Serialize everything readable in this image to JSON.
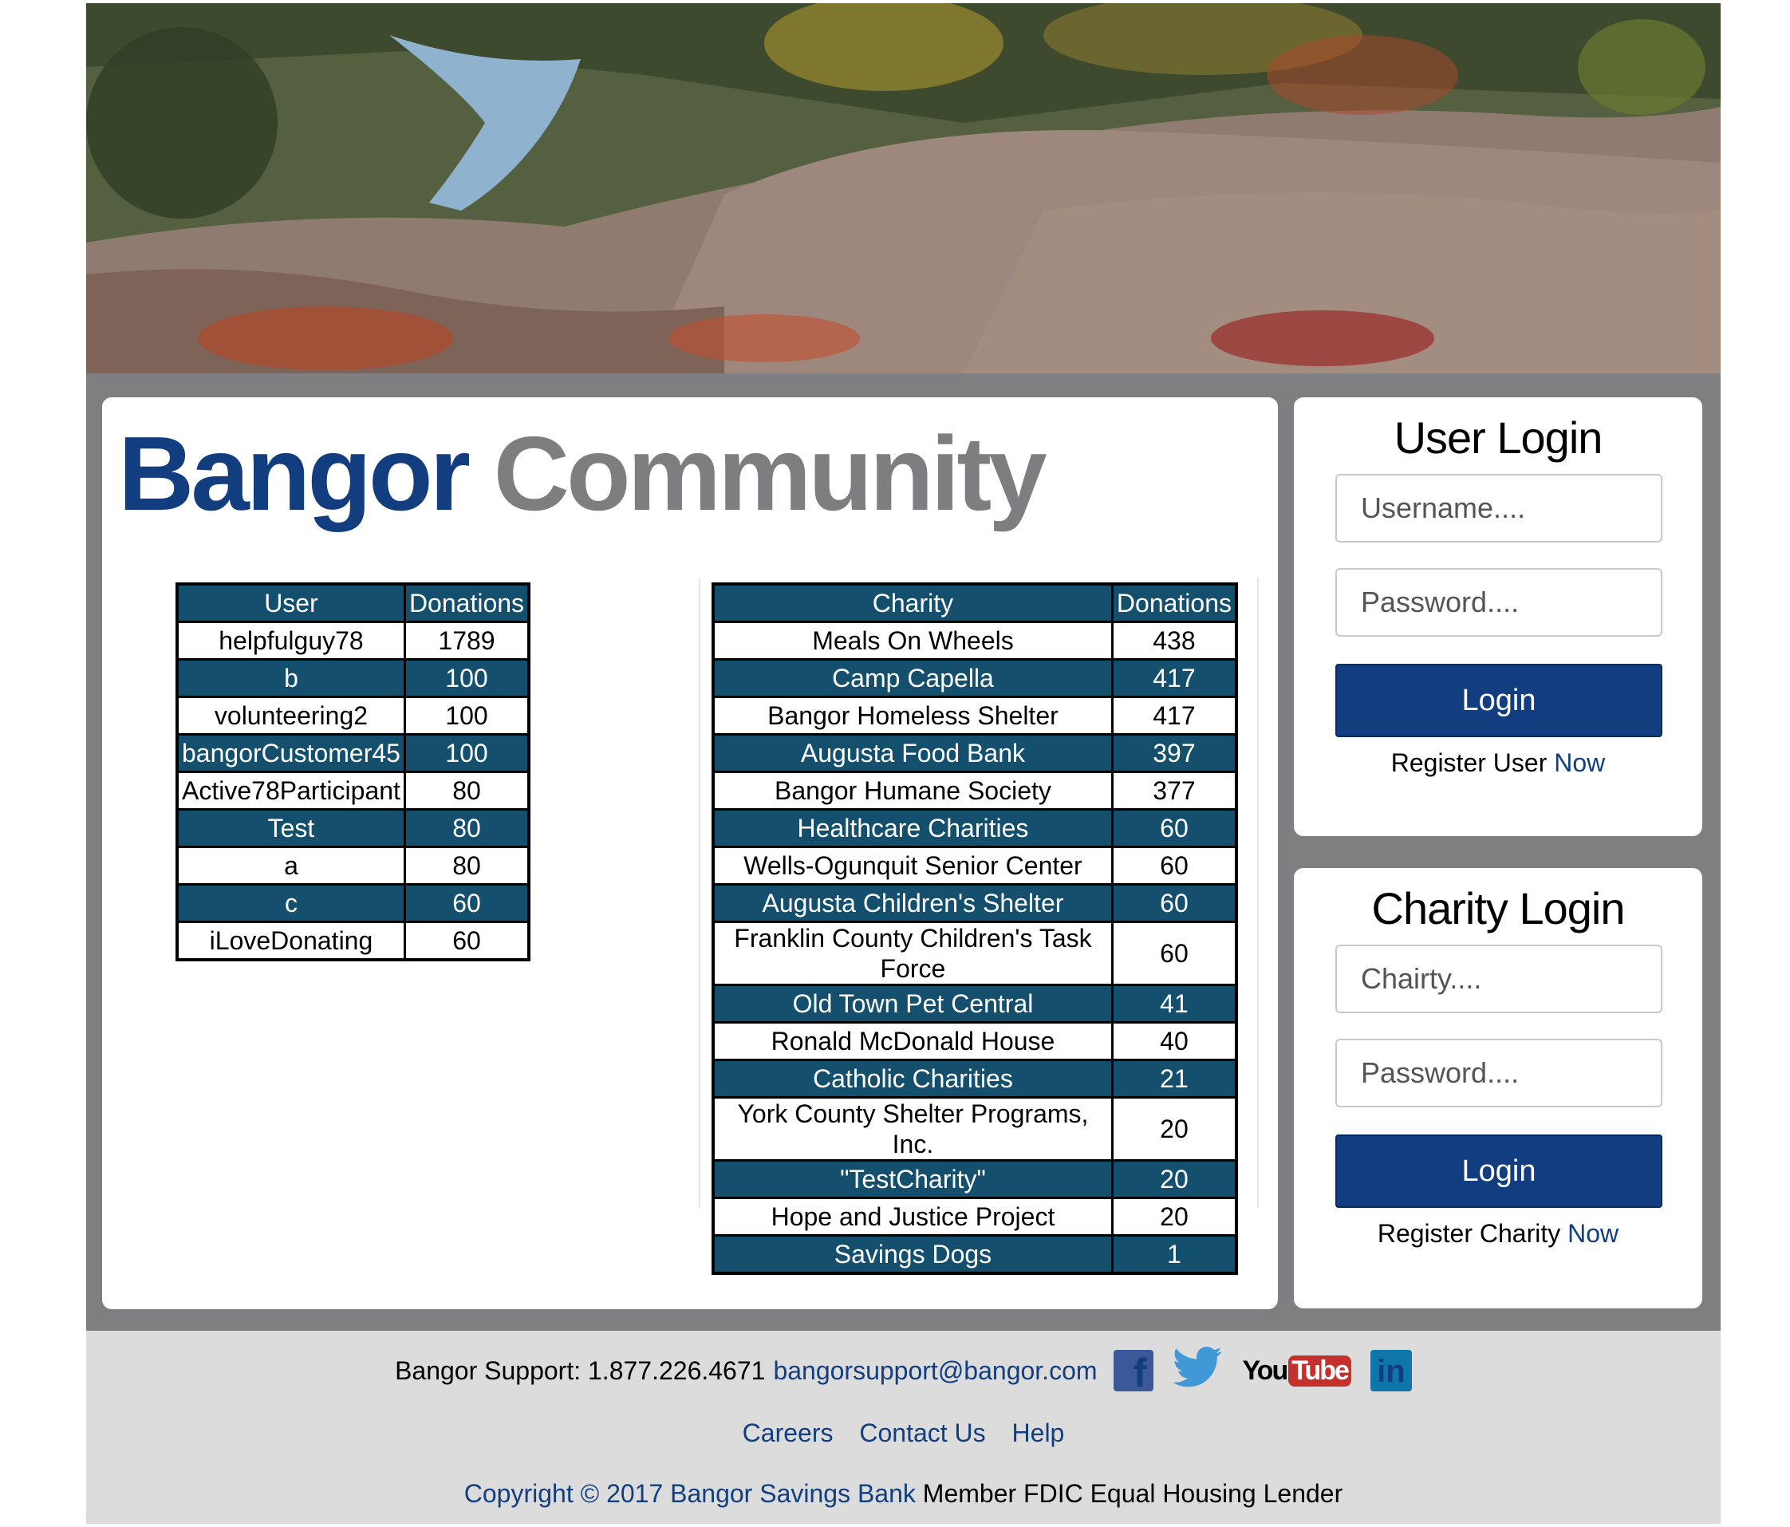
{
  "brand": {
    "word1": "Bangor",
    "word2": "Community"
  },
  "user_table": {
    "headers": [
      "User",
      "Donations"
    ],
    "rows": [
      [
        "helpfulguy78",
        "1789"
      ],
      [
        "b",
        "100"
      ],
      [
        "volunteering2",
        "100"
      ],
      [
        "bangorCustomer45",
        "100"
      ],
      [
        "Active78Participant",
        "80"
      ],
      [
        "Test",
        "80"
      ],
      [
        "a",
        "80"
      ],
      [
        "c",
        "60"
      ],
      [
        "iLoveDonating",
        "60"
      ]
    ]
  },
  "charity_table": {
    "headers": [
      "Charity",
      "Donations"
    ],
    "rows": [
      [
        "Meals On Wheels",
        "438"
      ],
      [
        "Camp Capella",
        "417"
      ],
      [
        "Bangor Homeless Shelter",
        "417"
      ],
      [
        "Augusta Food Bank",
        "397"
      ],
      [
        "Bangor Humane Society",
        "377"
      ],
      [
        "Healthcare Charities",
        "60"
      ],
      [
        "Wells-Ogunquit Senior Center",
        "60"
      ],
      [
        "Augusta Children's Shelter",
        "60"
      ],
      [
        "Franklin County Children's Task Force",
        "60"
      ],
      [
        "Old Town Pet Central",
        "41"
      ],
      [
        "Ronald McDonald House",
        "40"
      ],
      [
        "Catholic Charities",
        "21"
      ],
      [
        "York County Shelter Programs, Inc.",
        "20"
      ],
      [
        "\"TestCharity\"",
        "20"
      ],
      [
        "Hope and Justice Project",
        "20"
      ],
      [
        "Savings Dogs",
        "1"
      ]
    ]
  },
  "user_login": {
    "title": "User Login",
    "username_placeholder": "Username....",
    "password_placeholder": "Password....",
    "button": "Login",
    "register_text": "Register User",
    "register_link": "Now"
  },
  "charity_login": {
    "title": "Charity Login",
    "charity_placeholder": "Chairty....",
    "password_placeholder": "Password....",
    "button": "Login",
    "register_text": "Register Charity",
    "register_link": "Now"
  },
  "footer": {
    "support_label": "Bangor Support: 1.877.226.4671",
    "support_email": "bangorsupport@bangor.com",
    "social_icons": [
      "facebook-icon",
      "twitter-icon",
      "youtube-icon",
      "linkedin-icon"
    ],
    "youtube_you": "You",
    "youtube_tube": "Tube",
    "facebook_glyph": "f",
    "linkedin_glyph": "in",
    "links": [
      "Careers",
      "Contact Us",
      "Help"
    ],
    "copyright_link": "Copyright © 2017 Bangor Savings Bank",
    "copyright_rest": "Member FDIC Equal Housing Lender"
  },
  "colors": {
    "brand_blue": "#123e80",
    "brand_gray": "#7e7e80",
    "table_teal": "#14506e",
    "page_gray": "#7f7f81",
    "footer_gray": "#dcdcdc"
  }
}
